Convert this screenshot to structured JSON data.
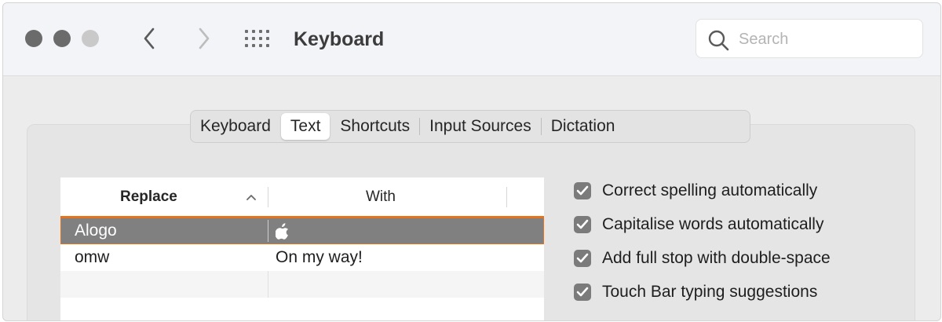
{
  "window": {
    "title": "Keyboard",
    "traffic_lights": [
      "close",
      "minimize",
      "zoom"
    ],
    "search": {
      "placeholder": "Search",
      "value": ""
    }
  },
  "tabs": [
    {
      "label": "Keyboard",
      "active": false
    },
    {
      "label": "Text",
      "active": true
    },
    {
      "label": "Shortcuts",
      "active": false
    },
    {
      "label": "Input Sources",
      "active": false
    },
    {
      "label": "Dictation",
      "active": false
    }
  ],
  "replacements": {
    "columns": {
      "replace": "Replace",
      "with": "With",
      "sort": "ascending"
    },
    "rows": [
      {
        "replace": "Alogo",
        "with": "",
        "selected": true,
        "with_icon": "apple-logo-icon"
      },
      {
        "replace": "omw",
        "with": "On my way!",
        "selected": false
      }
    ]
  },
  "options": [
    {
      "label": "Correct spelling automatically",
      "checked": true
    },
    {
      "label": "Capitalise words automatically",
      "checked": true
    },
    {
      "label": "Add full stop with double-space",
      "checked": true
    },
    {
      "label": "Touch Bar typing suggestions",
      "checked": true
    }
  ],
  "colors": {
    "selection_highlight": "#e5731e",
    "selected_row": "#808080",
    "checkbox": "#7b7b7b"
  }
}
